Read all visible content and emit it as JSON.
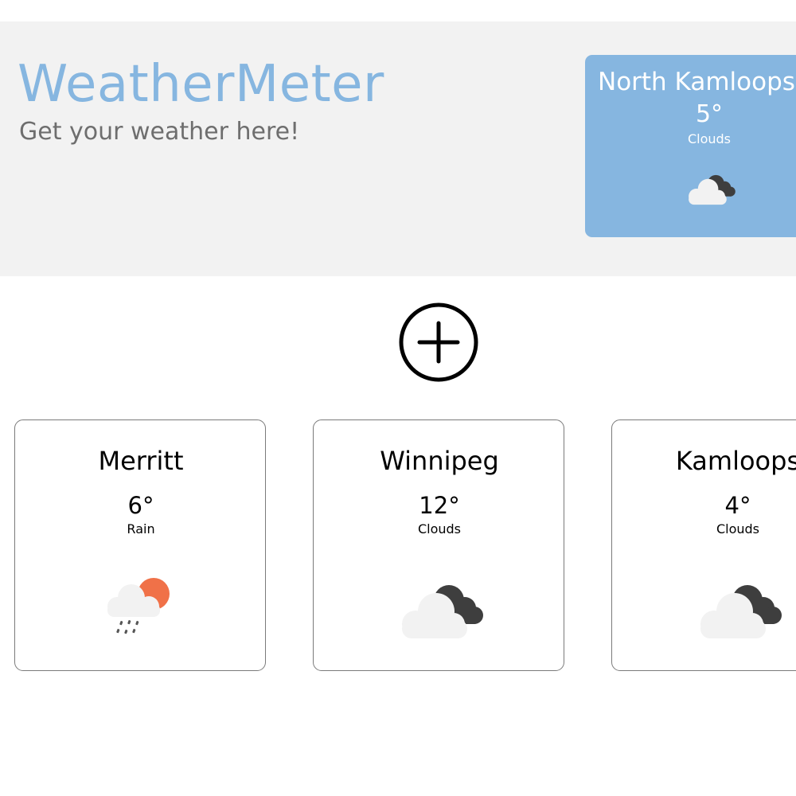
{
  "header": {
    "title": "WeatherMeter",
    "tagline": "Get your weather here!"
  },
  "current_location": {
    "city": "North Kamloops",
    "temperature": "5°",
    "condition": "Clouds",
    "icon": "cloudy-icon"
  },
  "add_button": {
    "icon": "add-circle-icon"
  },
  "cities": [
    {
      "name": "Merritt",
      "temperature": "6°",
      "condition": "Rain",
      "icon": "rain-sun-icon"
    },
    {
      "name": "Winnipeg",
      "temperature": "12°",
      "condition": "Clouds",
      "icon": "cloudy-icon"
    },
    {
      "name": "Kamloops",
      "temperature": "4°",
      "condition": "Clouds",
      "icon": "cloudy-icon"
    }
  ],
  "colors": {
    "accent": "#86b6e0",
    "hero_background": "#f2f2f2",
    "tagline": "#6e6e6e",
    "sun": "#f07148",
    "dark_cloud": "#3e3e3e",
    "light_cloud": "#f2f2f2"
  }
}
